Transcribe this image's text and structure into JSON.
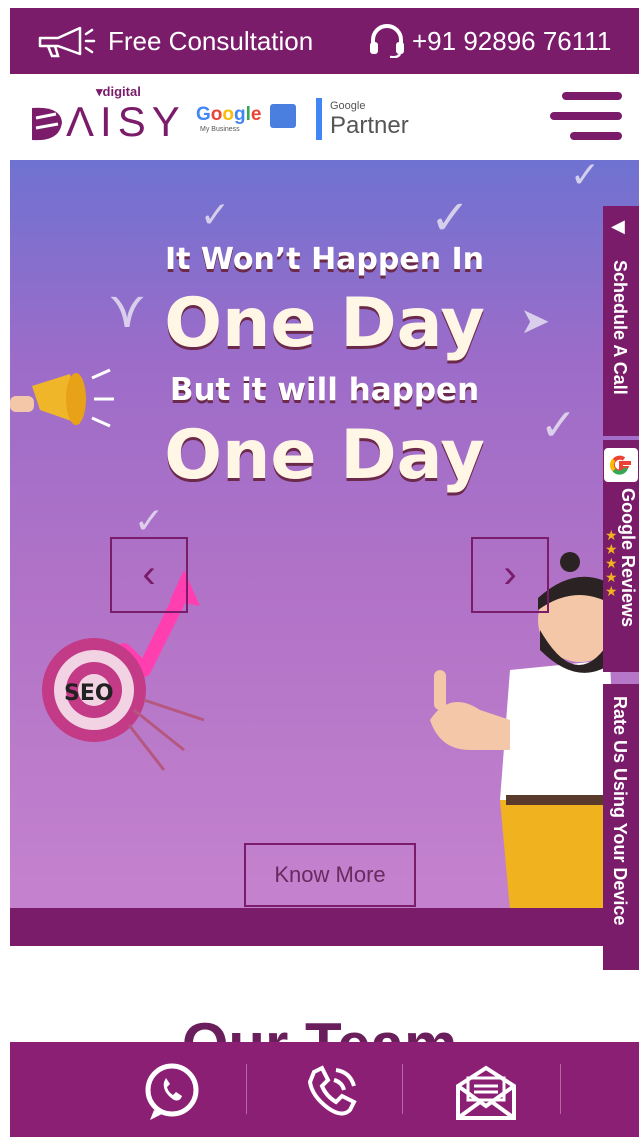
{
  "topbar": {
    "consultation_label": "Free Consultation",
    "phone_label": "+91 92896 76111"
  },
  "header": {
    "logo_small": "digital",
    "logo_main": "DAISY",
    "gmb_word": "Google",
    "gmb_sub": "My Business",
    "partner_small": "Google",
    "partner_big": "Partner"
  },
  "hero": {
    "line1": "It Won’t Happen In",
    "line2": "One Day",
    "line3": "But it will happen",
    "line4": "One Day",
    "seo_label": "SEO",
    "prev_label": "‹",
    "next_label": "›",
    "cta_label": "Know More"
  },
  "side_tabs": {
    "schedule": "Schedule A Call",
    "reviews": "Google Reviews",
    "rate": "Rate Us Using Your Device"
  },
  "section": {
    "team_title": "Our Team"
  },
  "bottom_bar": {
    "icons": [
      "whatsapp-icon",
      "phone-icon",
      "mail-icon"
    ]
  },
  "colors": {
    "brand": "#7a1c6a",
    "hero_top": "#6f72d1",
    "hero_bottom": "#c784cf",
    "bottom_bar": "#8b1f74"
  }
}
